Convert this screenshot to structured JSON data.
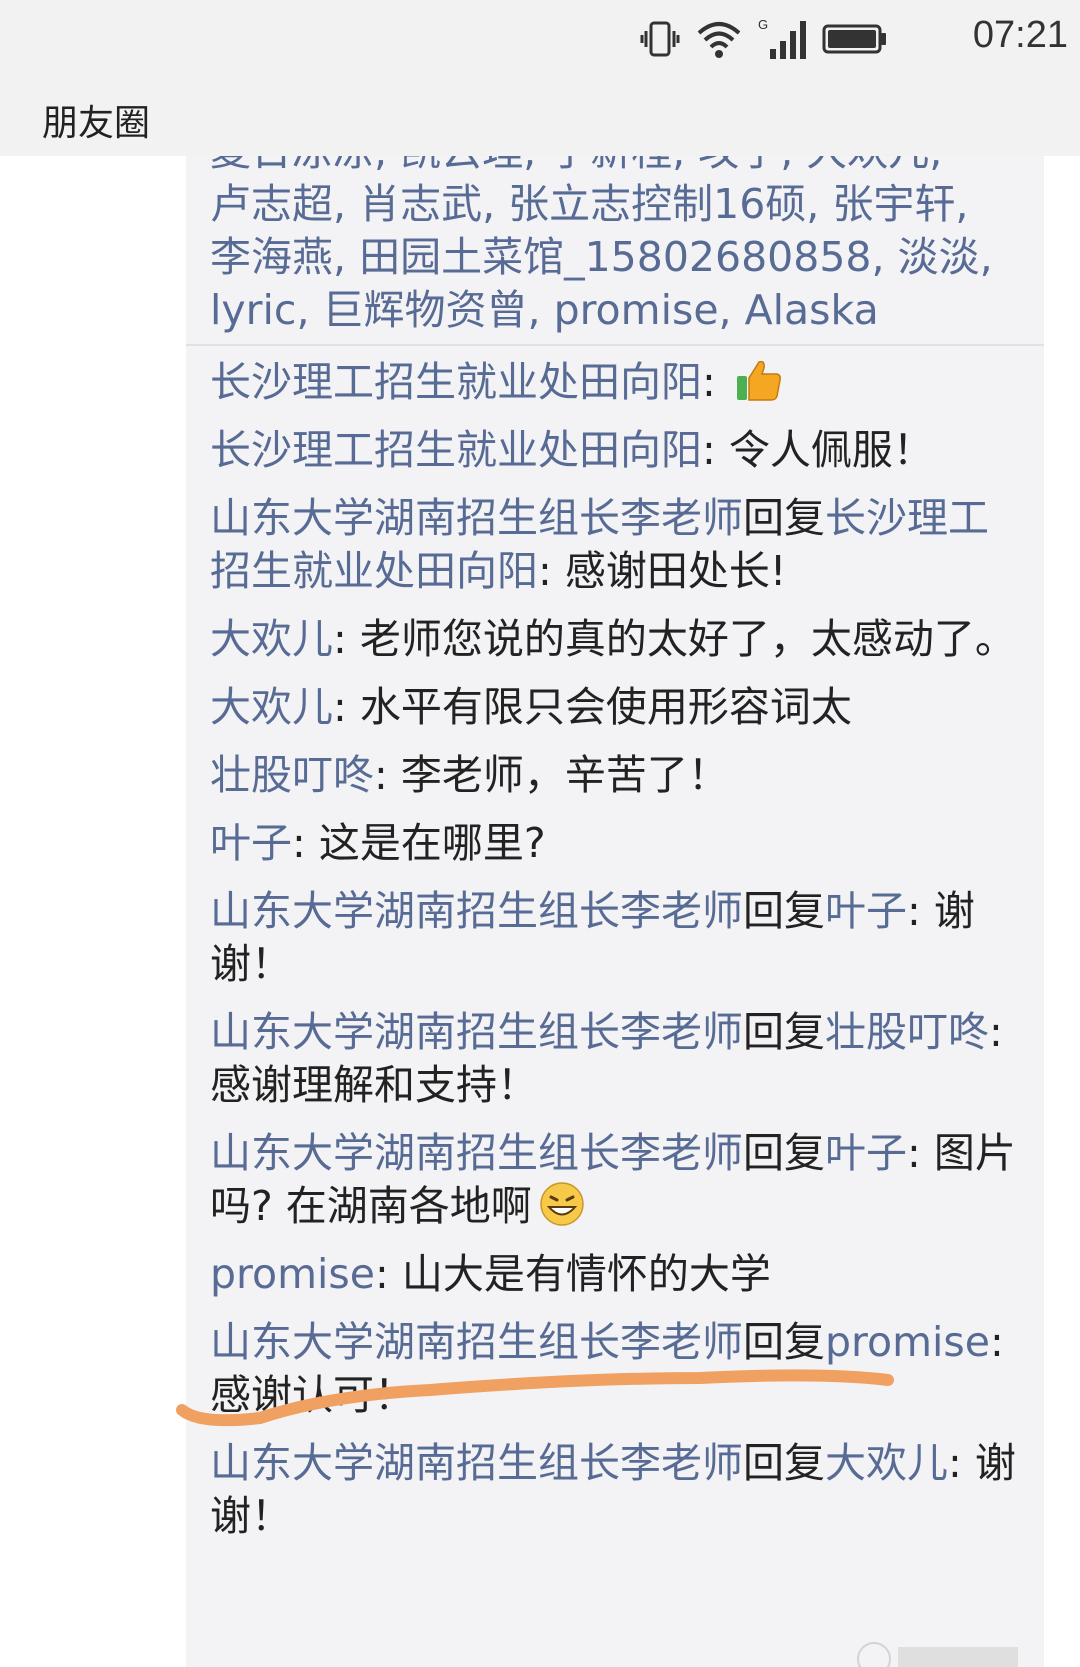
{
  "status_bar": {
    "time": "07:21",
    "network": "G"
  },
  "header": {
    "title": "朋友圈"
  },
  "likes": {
    "cut_line": "夏日凉凉, 凯云理, 于新程, 攻子, 大欢儿,",
    "names_text": "卢志超, 肖志武, 张立志控制16硕, 张宇轩, 李海燕, 田园土菜馆_15802680858, 淡淡, lyric, 巨辉物资曾, promise, Alaska"
  },
  "comments": [
    {
      "name": "长沙理工招生就业处田向阳",
      "sep": ": ",
      "text": "",
      "emoji": "thumbs-up"
    },
    {
      "name": "长沙理工招生就业处田向阳",
      "sep": ": ",
      "text": "令人佩服！"
    },
    {
      "name": "山东大学湖南招生组长李老师",
      "reply_word": "回复",
      "reply_to": "长沙理工招生就业处田向阳",
      "sep": ": ",
      "text": "感谢田处长!"
    },
    {
      "name": "大欢儿",
      "sep": ": ",
      "text": "老师您说的真的太好了，太感动了。"
    },
    {
      "name": "大欢儿",
      "sep": ": ",
      "text": "水平有限只会使用形容词太"
    },
    {
      "name": "壮股叮咚",
      "sep": ": ",
      "text": "李老师，辛苦了！"
    },
    {
      "name": "叶子",
      "sep": ": ",
      "text": "这是在哪里?"
    },
    {
      "name": "山东大学湖南招生组长李老师",
      "reply_word": "回复",
      "reply_to": "叶子",
      "sep": ": ",
      "text": "谢谢！"
    },
    {
      "name": "山东大学湖南招生组长李老师",
      "reply_word": "回复",
      "reply_to": "壮股叮咚",
      "sep": ": ",
      "text": "感谢理解和支持！"
    },
    {
      "name": "山东大学湖南招生组长李老师",
      "reply_word": "回复",
      "reply_to": "叶子",
      "sep": ": ",
      "text": "图片吗? 在湖南各地啊",
      "emoji": "grin"
    },
    {
      "name": "promise",
      "sep": ": ",
      "text": "山大是有情怀的大学"
    },
    {
      "name": "山东大学湖南招生组长李老师",
      "reply_word": "回复",
      "reply_to": "promise",
      "sep": ": ",
      "text": "感谢认可！"
    },
    {
      "name": "山东大学湖南招生组长李老师",
      "reply_word": "回复",
      "reply_to": "大欢儿",
      "sep": ": ",
      "text": "谢谢！"
    }
  ],
  "colors": {
    "name_link": "#576b95",
    "comment_bg": "#f3f3f5",
    "underline": "#f0a060"
  },
  "icons": [
    "vibrate-icon",
    "wifi-icon",
    "signal-icon",
    "battery-icon",
    "thumbs-up-emoji",
    "grin-emoji"
  ]
}
